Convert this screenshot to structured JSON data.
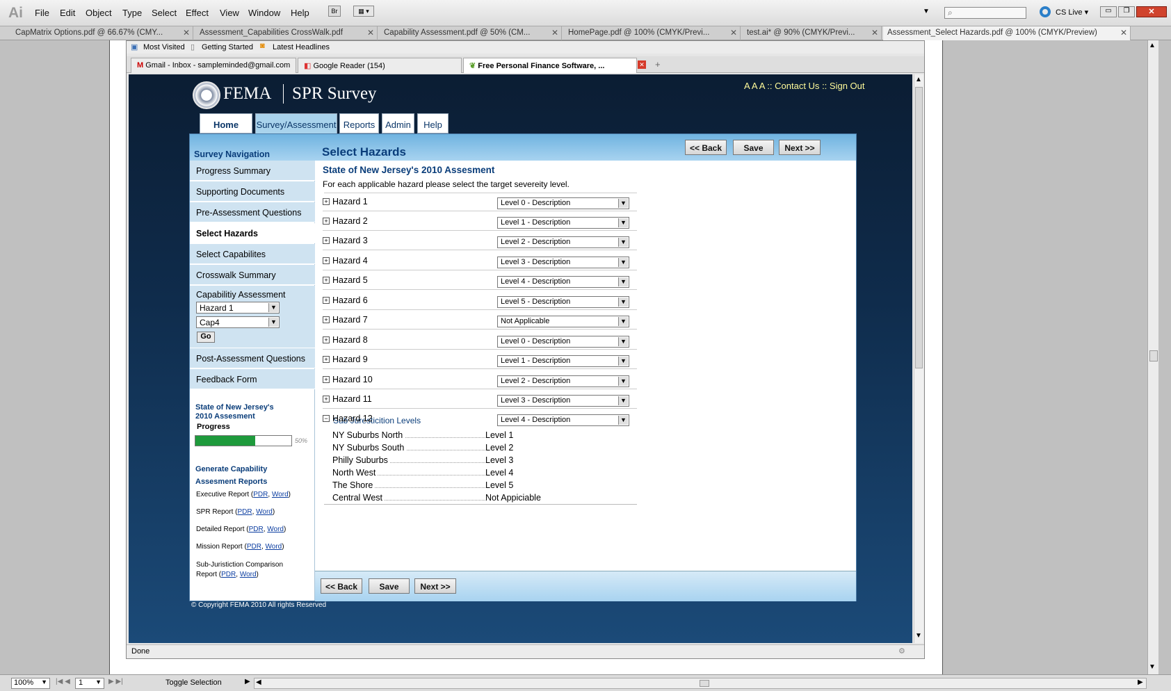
{
  "app": {
    "logo": "Ai",
    "menu": [
      "File",
      "Edit",
      "Object",
      "Type",
      "Select",
      "Effect",
      "View",
      "Window",
      "Help"
    ],
    "br_label": "Br",
    "cs_live": "CS Live",
    "doc_tabs": [
      "CapMatrix Options.pdf @ 66.67% (CMY...",
      "Assessment_Capabilities CrossWalk.pdf",
      "Capability Assessment.pdf @ 50% (CM...",
      "HomePage.pdf @ 100% (CMYK/Previ...",
      "test.ai* @ 90% (CMYK/Previ...",
      "Assessment_Select Hazards.pdf @ 100% (CMYK/Preview)"
    ],
    "zoom": "100%",
    "page": "1",
    "toggle": "Toggle Selection"
  },
  "browser": {
    "bookmarks": [
      "Most Visited",
      "Getting Started",
      "Latest Headlines"
    ],
    "tabs": [
      "Gmail - Inbox - sampleminded@gmail.com",
      "Google Reader (154)",
      "Free Personal Finance Software, ..."
    ],
    "plus": "+",
    "status": "Done"
  },
  "site": {
    "brand": "FEMA",
    "product": "SPR Survey",
    "toplinks": {
      "sizes": "A A A ::",
      "contact": "Contact Us",
      "sep": "::",
      "signout": "Sign Out"
    },
    "nav": [
      "Home",
      "Survey/Assessment",
      "Reports",
      "Admin",
      "Help"
    ],
    "sidebar": {
      "heading": "Survey Navigation",
      "items": [
        "Progress Summary",
        "Supporting Documents",
        "Pre-Assessment Questions",
        "Select Hazards",
        "Select Capabilites",
        "Crosswalk Summary"
      ],
      "cap_label": "Capabilitiy Assessment",
      "hazard_select": "Hazard 1",
      "cap_select": "Cap4",
      "go": "Go",
      "items2": [
        "Post-Assessment Questions",
        "Feedback Form"
      ],
      "progress_title_1": "State of New Jersey's",
      "progress_title_2": "2010 Assesment",
      "progress_label": "Progress",
      "progress_value": 0.5,
      "progress_text": "50%",
      "reports_title_1": "Generate Capability",
      "reports_title_2": "Assesment Reports",
      "reports": [
        {
          "name": "Executive Report (",
          "pdr": "PDR",
          "sep": ", ",
          "word": "Word",
          "end": ")"
        },
        {
          "name": "SPR Report (",
          "pdr": "PDR",
          "sep": ", ",
          "word": "Word",
          "end": ")"
        },
        {
          "name": "Detailed Report (",
          "pdr": "PDR",
          "sep": ", ",
          "word": "Word",
          "end": ")"
        },
        {
          "name": "Mission Report (",
          "pdr": "PDR",
          "sep": ", ",
          "word": "Word",
          "end": ")"
        }
      ],
      "subjur_1": "Sub-Juristiction Comparison",
      "subjur_2": "Report (",
      "subjur_pdr": "PDR",
      "subjur_word": "Word"
    },
    "main": {
      "title": "Select Hazards",
      "back": "<< Back",
      "save": "Save",
      "next": "Next >>",
      "heading": "State of New Jersey's 2010 Assesment",
      "instructions": "For each applicable hazard please select the target severeity level.",
      "hazards": [
        {
          "name": "Hazard 1",
          "level": "Level 0 - Description"
        },
        {
          "name": "Hazard 2",
          "level": "Level 1 - Description"
        },
        {
          "name": "Hazard 3",
          "level": "Level 2 - Description"
        },
        {
          "name": "Hazard 4",
          "level": "Level 3 - Description"
        },
        {
          "name": "Hazard 5",
          "level": "Level 4 - Description"
        },
        {
          "name": "Hazard 6",
          "level": "Level 5 - Description"
        },
        {
          "name": "Hazard 7",
          "level": "Not Applicable"
        },
        {
          "name": "Hazard 8",
          "level": "Level 0 - Description"
        },
        {
          "name": "Hazard 9",
          "level": "Level 1 - Description"
        },
        {
          "name": "Hazard 10",
          "level": "Level 2 - Description"
        },
        {
          "name": "Hazard 11",
          "level": "Level 3 - Description"
        },
        {
          "name": "Hazard 12",
          "level": "Level 4 - Description"
        }
      ],
      "sub_title": "Sub Juresticition Levels",
      "sub_rows": [
        {
          "name": "NY Suburbs North",
          "level": "Level 1"
        },
        {
          "name": "NY Suburbs South",
          "level": "Level 2"
        },
        {
          "name": "Philly Suburbs",
          "level": "Level 3"
        },
        {
          "name": "North West",
          "level": "Level 4"
        },
        {
          "name": "The Shore",
          "level": "Level 5"
        },
        {
          "name": "Central West",
          "level": "Not Appiciable"
        }
      ]
    },
    "copyright": "© Copyright FEMA 2010 All rights Reserved"
  }
}
